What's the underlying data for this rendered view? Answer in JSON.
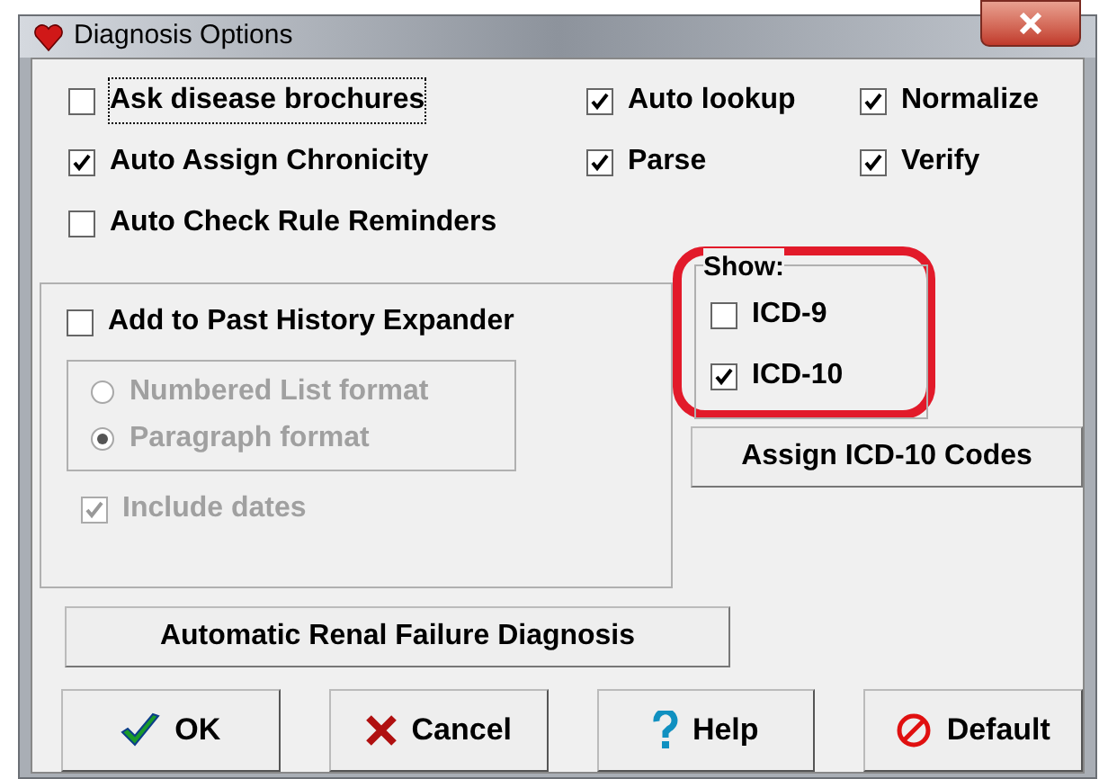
{
  "window": {
    "title": "Diagnosis Options"
  },
  "options": [
    {
      "label": "Ask disease brochures",
      "checked": false,
      "focused": true
    },
    {
      "label": "Auto lookup",
      "checked": true,
      "focused": false
    },
    {
      "label": "Normalize",
      "checked": true,
      "focused": false
    },
    {
      "label": "Auto Assign Chronicity",
      "checked": true,
      "focused": false
    },
    {
      "label": "Parse",
      "checked": true,
      "focused": false
    },
    {
      "label": "Verify",
      "checked": true,
      "focused": false
    },
    {
      "label": "Auto Check Rule Reminders",
      "checked": false,
      "focused": false
    }
  ],
  "past_history": {
    "label": "Add to Past History Expander",
    "checked": false,
    "formats": [
      {
        "label": "Numbered List format",
        "selected": false,
        "disabled": true
      },
      {
        "label": "Paragraph format",
        "selected": true,
        "disabled": true
      }
    ],
    "include_dates": {
      "label": "Include dates",
      "checked": true,
      "disabled": true
    }
  },
  "show": {
    "title": "Show:",
    "highlighted": true,
    "items": [
      {
        "label": "ICD-9",
        "checked": false
      },
      {
        "label": "ICD-10",
        "checked": true
      }
    ]
  },
  "assign_button": "Assign ICD-10 Codes",
  "renal_button": "Automatic Renal Failure Diagnosis",
  "buttons": [
    {
      "kind": "ok",
      "label": "OK"
    },
    {
      "kind": "cancel",
      "label": "Cancel"
    },
    {
      "kind": "help",
      "label": "Help"
    },
    {
      "kind": "default",
      "label": "Default"
    }
  ]
}
